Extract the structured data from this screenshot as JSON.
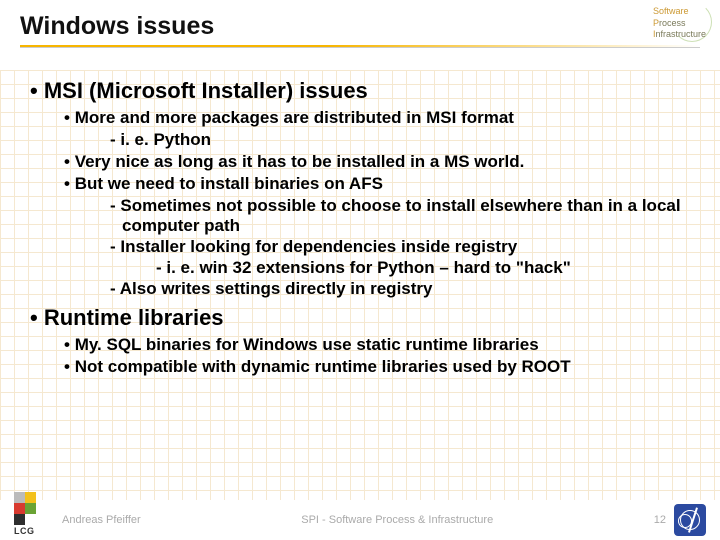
{
  "header": {
    "title": "Windows issues",
    "spi_logo": {
      "l1": "Software",
      "l2": "Process",
      "l3": "Infrastructure"
    }
  },
  "slide": {
    "s1": {
      "title": "MSI (Microsoft Installer) issues",
      "i1": "More and more packages are distributed in MSI format",
      "i1a": "i. e. Python",
      "i2": "Very nice as long as it has to be installed in a MS world.",
      "i3": "But we need to install binaries on AFS",
      "i3a": "Sometimes not possible to choose to install elsewhere than in a local computer path",
      "i3b": "Installer looking for dependencies inside registry",
      "i3b1": "i. e. win 32 extensions for Python – hard to \"hack\"",
      "i3c": "Also writes settings directly in registry"
    },
    "s2": {
      "title": "Runtime libraries",
      "i1": "My. SQL binaries for Windows use static runtime libraries",
      "i2": "Not compatible with dynamic runtime libraries used by ROOT"
    }
  },
  "footer": {
    "lcg": "LCG",
    "author": "Andreas Pfeiffer",
    "center": "SPI - Software Process & Infrastructure",
    "page": "12"
  }
}
